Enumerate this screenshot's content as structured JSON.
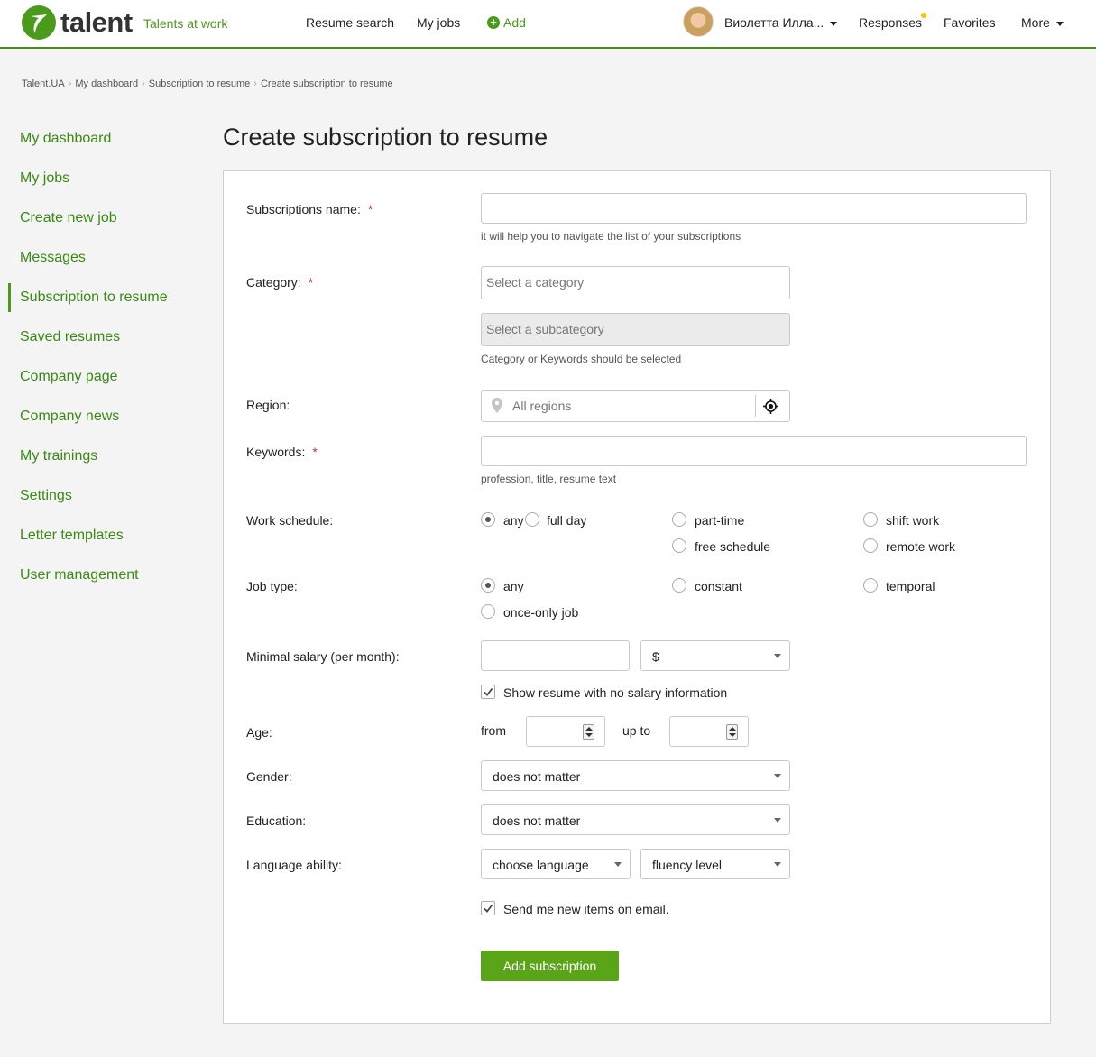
{
  "header": {
    "logo_text": "talent",
    "tagline": "Talents at work",
    "nav": {
      "resume_search": "Resume search",
      "my_jobs": "My jobs",
      "add": "Add"
    },
    "user_name": "Виолетта Илла...",
    "responses": "Responses",
    "favorites": "Favorites",
    "more": "More"
  },
  "breadcrumb": [
    "Talent.UA",
    "My dashboard",
    "Subscription to resume",
    "Create subscription to resume"
  ],
  "sidebar": {
    "active_index": 4,
    "items": [
      {
        "label": "My dashboard"
      },
      {
        "label": "My jobs"
      },
      {
        "label": "Create new job"
      },
      {
        "label": "Messages"
      },
      {
        "label": "Subscription to resume"
      },
      {
        "label": "Saved resumes"
      },
      {
        "label": "Company page"
      },
      {
        "label": "Company news"
      },
      {
        "label": "My trainings"
      },
      {
        "label": "Settings"
      },
      {
        "label": "Letter templates"
      },
      {
        "label": "User management"
      }
    ]
  },
  "page": {
    "title": "Create subscription to resume"
  },
  "form": {
    "required_mark": "*",
    "subscription_name": {
      "label": "Subscriptions name:",
      "value": "",
      "hint": "it will help you to navigate the list of your subscriptions"
    },
    "category": {
      "label": "Category:",
      "placeholder": "Select a category",
      "subcategory_placeholder": "Select a subcategory",
      "hint": "Category or Keywords should be selected"
    },
    "region": {
      "label": "Region:",
      "placeholder": "All regions"
    },
    "keywords": {
      "label": "Keywords:",
      "value": "",
      "hint": "profession, title, resume text"
    },
    "work_schedule": {
      "label": "Work schedule:",
      "options": [
        "any",
        "full day",
        "part-time",
        "shift work",
        "free schedule",
        "remote work"
      ],
      "selected": "any"
    },
    "job_type": {
      "label": "Job type:",
      "options": [
        "any",
        "constant",
        "temporal",
        "once-only job"
      ],
      "selected": "any"
    },
    "salary": {
      "label": "Minimal salary (per month):",
      "value": "",
      "currency": "$",
      "no_salary_label": "Show resume with no salary information",
      "no_salary_checked": true
    },
    "age": {
      "label": "Age:",
      "from_label": "from",
      "to_label": "up to",
      "from_value": "",
      "to_value": ""
    },
    "gender": {
      "label": "Gender:",
      "value": "does not matter"
    },
    "education": {
      "label": "Education:",
      "value": "does not matter"
    },
    "language": {
      "label": "Language ability:",
      "language_value": "choose language",
      "level_value": "fluency level"
    },
    "email": {
      "label": "Send me new items on email.",
      "checked": true
    },
    "submit_label": "Add subscription"
  },
  "colors": {
    "brand_green": "#4a9a1c",
    "button_green": "#5aa517",
    "required_red": "#c0392b",
    "notification_yellow": "#f5c400"
  },
  "icons": [
    "logo-icon",
    "add-icon",
    "avatar",
    "caret-down-icon",
    "map-pin-icon",
    "locate-icon",
    "checkmark-icon",
    "spinner-up-icon",
    "spinner-down-icon"
  ]
}
